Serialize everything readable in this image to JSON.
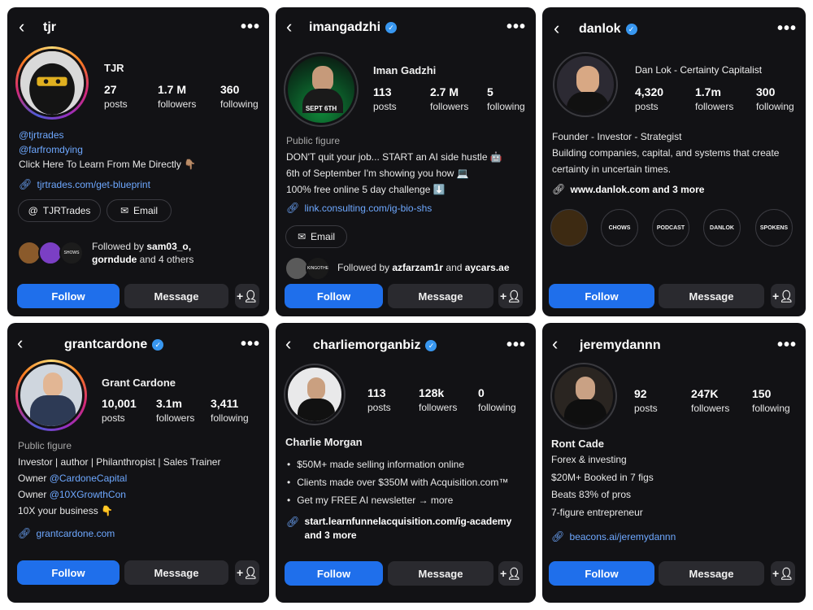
{
  "profiles": [
    {
      "username": "tjr",
      "display_name": "TJR",
      "stats": [
        {
          "num": "27",
          "label": "posts"
        },
        {
          "num": "1.7 M",
          "label": "followers"
        },
        {
          "num": "360",
          "label": "following"
        }
      ],
      "bio_lines": [
        "@tjrtrades",
        "@farfromdying",
        "Click Here To Learn From Me Directly 👇🏽"
      ],
      "link": "tjrtrades.com/get-blueprint",
      "pills": [
        "TJRTrades",
        "Email"
      ],
      "followed_by": {
        "prefix": "Followed by ",
        "name": "sam03_o,",
        "line2_name": "gorndude",
        "suffix": " and 4 others"
      },
      "mini_avatar_text": "SHOWS",
      "buttons": {
        "follow": "Follow",
        "message": "Message"
      }
    },
    {
      "username": "imangadzhi",
      "display_name": "Iman Gadzhi",
      "avatar_text": "SEPT 6TH",
      "stats": [
        {
          "num": "113",
          "label": "posts"
        },
        {
          "num": "2.7 M",
          "label": "followers"
        },
        {
          "num": "5",
          "label": "following"
        }
      ],
      "category": "Public figure",
      "bio_lines": [
        "DON'T quit your job... START an AI side hustle 🤖",
        "6th of September I'm showing you how 💻",
        "100% free online 5 day challenge ⬇️"
      ],
      "link": "link.consulting.com/ig-bio-shs",
      "pills": [
        "Email"
      ],
      "followed_by": {
        "prefix": "Followed by ",
        "name": "azfarzam1r",
        "and": " and ",
        "name2": "aycars.ae"
      },
      "mini_avatar_text": "KINGOTHE",
      "buttons": {
        "follow": "Follow",
        "message": "Message"
      }
    },
    {
      "username": "danlok",
      "display_name": "Dan Lok - Certainty Capitalist",
      "stats": [
        {
          "num": "4,320",
          "label": "posts"
        },
        {
          "num": "1.7m",
          "label": "followers"
        },
        {
          "num": "300",
          "label": "following"
        }
      ],
      "bio_lines": [
        "Founder - Investor - Strategist",
        "Building companies, capital, and systems that create",
        "certainty in uncertain times."
      ],
      "link": "www.danlok.com and 3 more",
      "highlights": [
        "",
        "CHOWS",
        "PODCAST",
        "DANLOK",
        "SPOKENS"
      ],
      "buttons": {
        "follow": "Follow",
        "message": "Message"
      }
    },
    {
      "username": "grantcardone",
      "display_name": "Grant Cardone",
      "stats": [
        {
          "num": "10,001",
          "label": "posts"
        },
        {
          "num": "3.1m",
          "label": "followers"
        },
        {
          "num": "3,411",
          "label": "following"
        }
      ],
      "category": "Public figure",
      "bio_line1": "Investor | author | Philanthropist | Sales Trainer",
      "owner_prefix": "Owner ",
      "owner1": "@CardoneCapital",
      "owner2": "@10XGrowthCon",
      "bio_last": "10X your business 👇",
      "link": "grantcardone.com",
      "buttons": {
        "follow": "Follow",
        "message": "Message"
      }
    },
    {
      "username": "charliemorganbiz",
      "display_name": "Charlie Morgan",
      "stats": [
        {
          "num": "113",
          "label": "posts"
        },
        {
          "num": "128k",
          "label": "followers"
        },
        {
          "num": "0",
          "label": "following"
        }
      ],
      "bullets": [
        "$50M+ made selling information online",
        "Clients made over $350M with Acquisition.com™",
        "Get my FREE AI newsletter → more"
      ],
      "link_line1": "start.learnfunnelacquisition.com/ig-academy",
      "link_line2": "and 3 more",
      "buttons": {
        "follow": "Follow",
        "message": "Message"
      }
    },
    {
      "username": "jeremydannn",
      "display_name": "Ront Cade",
      "stats": [
        {
          "num": "92",
          "label": "posts"
        },
        {
          "num": "247K",
          "label": "followers"
        },
        {
          "num": "150",
          "label": "following"
        }
      ],
      "bio_lines": [
        "Forex & investing",
        "$20M+ Booked in 7 figs",
        "Beats 83% of pros",
        "7-figure entrepreneur"
      ],
      "link": "beacons.ai/jeremydannn",
      "buttons": {
        "follow": "Follow",
        "message": "Message"
      }
    }
  ]
}
